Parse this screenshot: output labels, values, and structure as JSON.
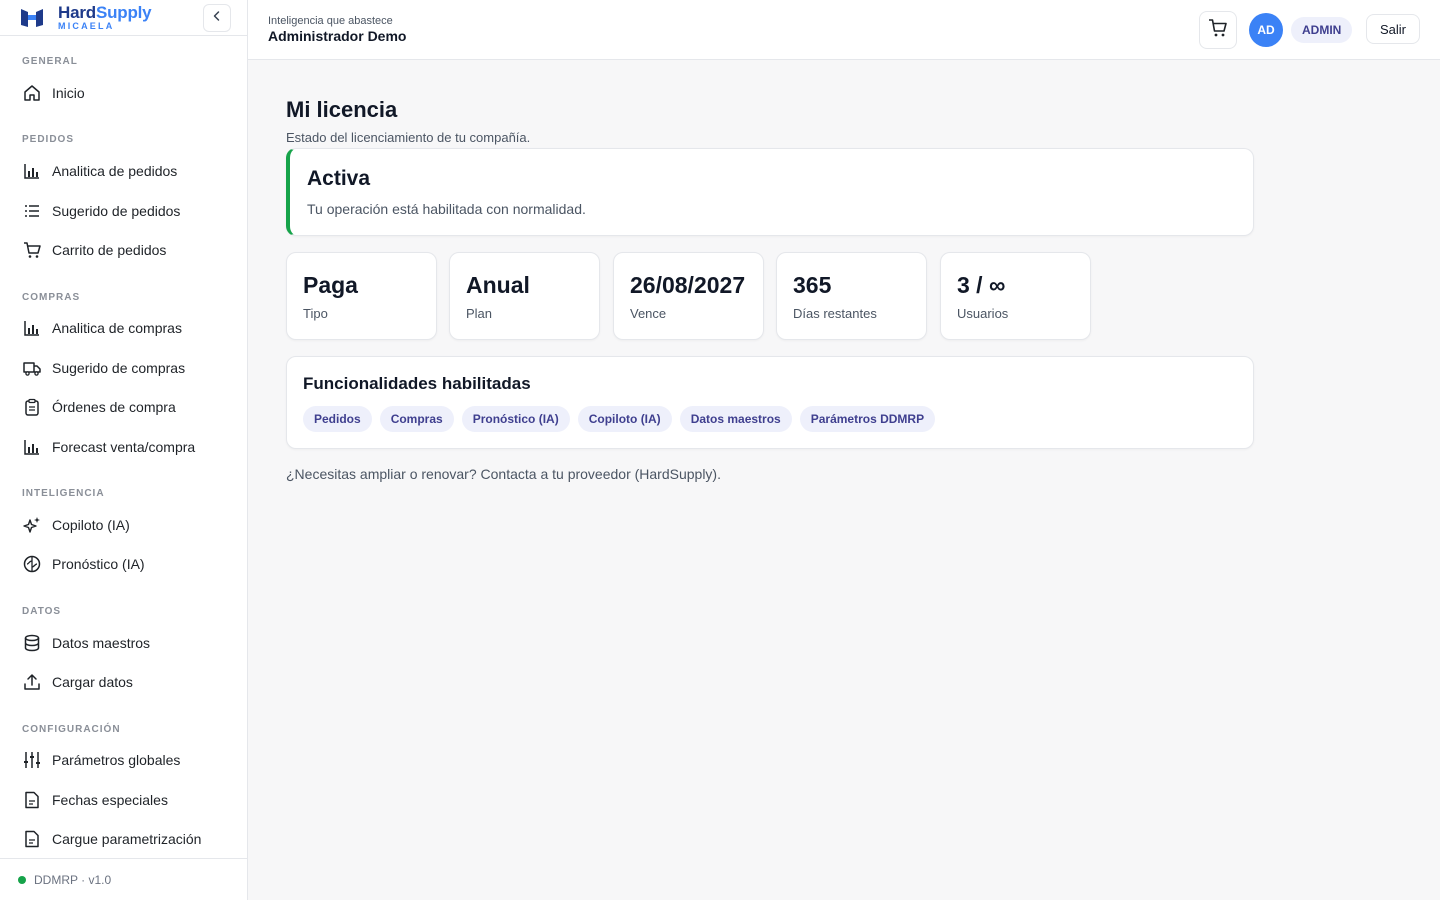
{
  "brand": {
    "name_main": "Hard",
    "name_accent": "Supply",
    "subtitle": "MICAELA",
    "primary_color": "#1e3a8a",
    "accent_color": "#3b82f6"
  },
  "sidebar": {
    "sections": [
      {
        "label": "GENERAL"
      },
      {
        "label": "PEDIDOS"
      },
      {
        "label": "COMPRAS"
      },
      {
        "label": "INTELIGENCIA"
      },
      {
        "label": "DATOS"
      },
      {
        "label": "CONFIGURACIÓN"
      }
    ],
    "items": [
      {
        "label": "Inicio",
        "icon": "home-icon"
      },
      {
        "label": "Analitica de pedidos",
        "icon": "bar-chart-icon"
      },
      {
        "label": "Sugerido de pedidos",
        "icon": "list-icon"
      },
      {
        "label": "Carrito de pedidos",
        "icon": "cart-icon"
      },
      {
        "label": "Analitica de compras",
        "icon": "bar-chart-icon"
      },
      {
        "label": "Sugerido de compras",
        "icon": "truck-icon"
      },
      {
        "label": "Órdenes de compra",
        "icon": "clipboard-icon"
      },
      {
        "label": "Forecast venta/compra",
        "icon": "bar-chart-icon"
      },
      {
        "label": "Copiloto (IA)",
        "icon": "sparkles-icon"
      },
      {
        "label": "Pronóstico (IA)",
        "icon": "brain-icon"
      },
      {
        "label": "Datos maestros",
        "icon": "database-icon"
      },
      {
        "label": "Cargar datos",
        "icon": "upload-icon"
      },
      {
        "label": "Parámetros globales",
        "icon": "sliders-icon"
      },
      {
        "label": "Fechas especiales",
        "icon": "file-icon"
      },
      {
        "label": "Cargue parametrización",
        "icon": "file-icon"
      }
    ],
    "footer": {
      "status": "DDMRP · v1.0",
      "status_color": "#16a34a"
    }
  },
  "topbar": {
    "subtitle": "Inteligencia que abastece",
    "title": "Administrador Demo",
    "avatar_initials": "AD",
    "role": "ADMIN",
    "logout_label": "Salir"
  },
  "main": {
    "title": "Mi licencia",
    "subtitle": "Estado del licenciamiento de tu compañía.",
    "status": {
      "title": "Activa",
      "description": "Tu operación está habilitada con normalidad.",
      "color": "#16a34a"
    },
    "stats": [
      {
        "value": "Paga",
        "label": "Tipo"
      },
      {
        "value": "Anual",
        "label": "Plan"
      },
      {
        "value": "26/08/2027",
        "label": "Vence"
      },
      {
        "value": "365",
        "label": "Días restantes"
      },
      {
        "value": "3 / ∞",
        "label": "Usuarios"
      }
    ],
    "features": {
      "title": "Funcionalidades habilitadas",
      "items": [
        "Pedidos",
        "Compras",
        "Pronóstico (IA)",
        "Copiloto (IA)",
        "Datos maestros",
        "Parámetros DDMRP"
      ]
    },
    "footer_note": "¿Necesitas ampliar o renovar? Contacta a tu proveedor (HardSupply)."
  }
}
